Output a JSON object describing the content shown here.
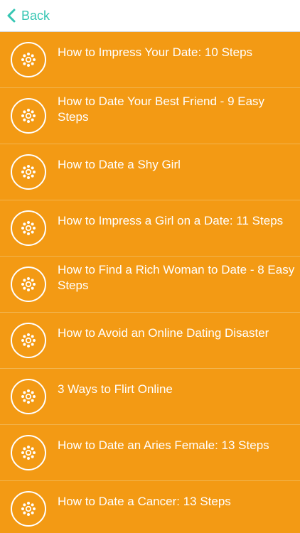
{
  "nav": {
    "back_label": "Back"
  },
  "colors": {
    "row_background": "#f39a14",
    "accent": "#36c6b3",
    "row_text": "#ffffff"
  },
  "list": {
    "items": [
      {
        "title": "How to Impress Your Date: 10 Steps",
        "icon": "flower-dots-icon"
      },
      {
        "title": "How to Date Your Best Friend - 9 Easy Steps",
        "icon": "flower-dots-icon"
      },
      {
        "title": "How to Date a Shy Girl",
        "icon": "flower-dots-icon"
      },
      {
        "title": "How to Impress a Girl on a Date: 11 Steps",
        "icon": "flower-dots-icon"
      },
      {
        "title": "How to Find a Rich Woman to Date - 8 Easy Steps",
        "icon": "flower-dots-icon"
      },
      {
        "title": "How to Avoid an Online Dating Disaster",
        "icon": "flower-dots-icon"
      },
      {
        "title": "3 Ways to Flirt Online",
        "icon": "flower-dots-icon"
      },
      {
        "title": "How to Date an Aries Female: 13 Steps",
        "icon": "flower-dots-icon"
      },
      {
        "title": "How to Date a Cancer: 13 Steps",
        "icon": "flower-dots-icon"
      }
    ]
  }
}
